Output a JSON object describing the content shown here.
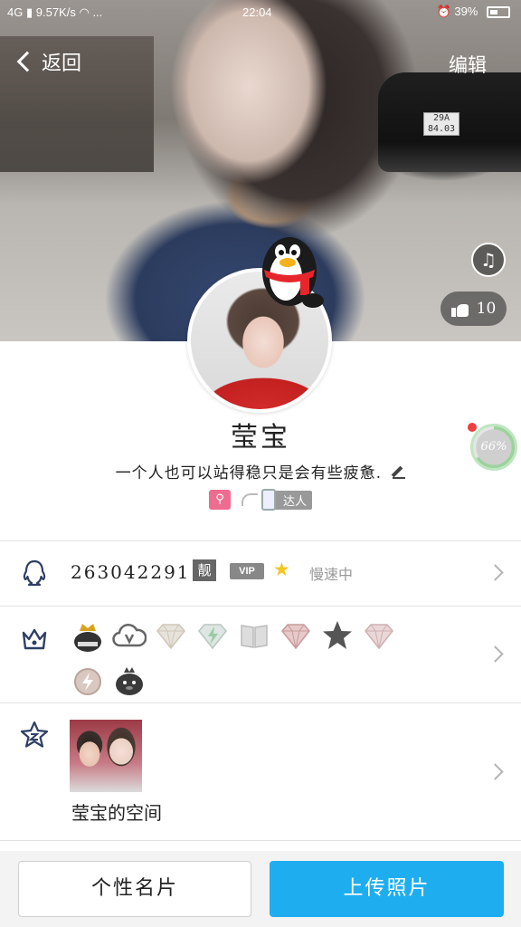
{
  "status_bar": {
    "network": "4G",
    "speed": "9.57K/s",
    "dots": "...",
    "time": "22:04",
    "battery": "39%"
  },
  "header": {
    "back_label": "返回",
    "edit_label": "编辑",
    "like_count": "10"
  },
  "profile": {
    "nickname": "莹宝",
    "signature": "一个人也可以站得稳只是会有些疲惫.",
    "badge_daren": "达人",
    "progress": "66%",
    "progress_value": 0.66
  },
  "info_row": {
    "qq_number": "2630422911",
    "liang_tag": "靓",
    "vip_tag": "VIP",
    "star": "★",
    "status_text": "慢速中"
  },
  "privileges": {
    "icons": [
      "qq-penguin-crown-icon",
      "cloud-v-icon",
      "diamond-icon",
      "green-diamond-icon",
      "book-icon",
      "red-diamond-icon",
      "star-icon",
      "pink-diamond-icon",
      "lightning-icon",
      "penguin-icon"
    ]
  },
  "space": {
    "label": "莹宝的空间"
  },
  "bottom": {
    "card_label": "个性名片",
    "upload_label": "上传照片"
  },
  "colors": {
    "accent": "#1eaef0",
    "row_icon": "#2f3f66"
  }
}
